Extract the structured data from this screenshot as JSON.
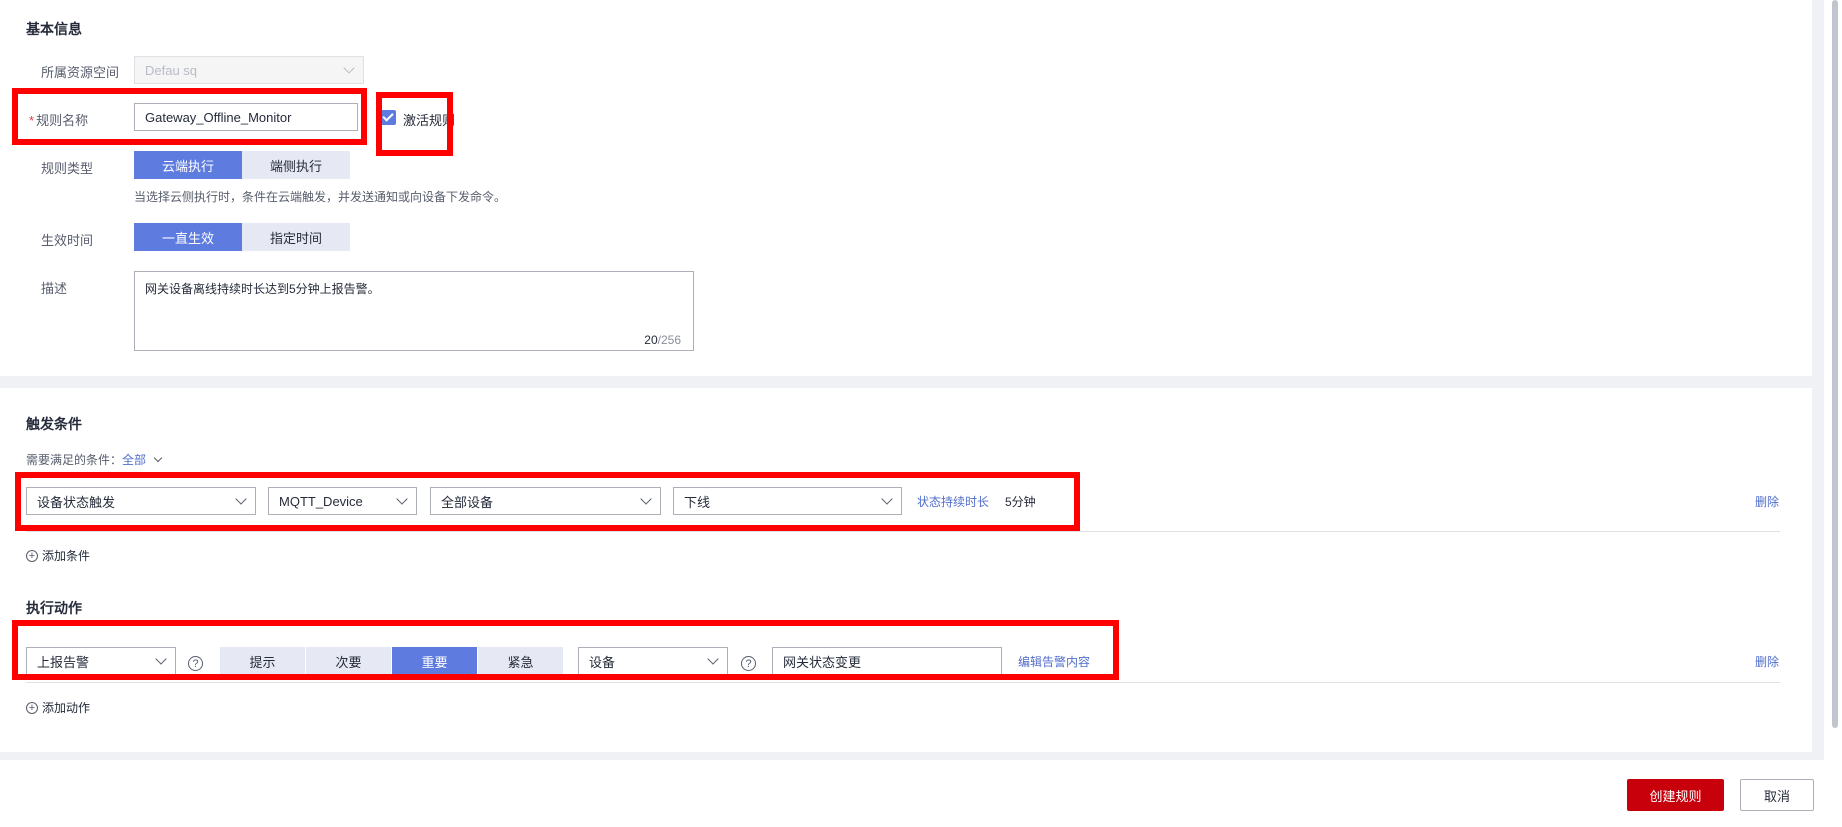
{
  "basic_info": {
    "title": "基本信息",
    "resource_space": {
      "label": "所属资源空间",
      "value": "Defau              sq"
    },
    "rule_name": {
      "required_mark": "*",
      "label": "规则名称",
      "value": "Gateway_Offline_Monitor"
    },
    "activate": {
      "label": "激活规则",
      "checked": true
    },
    "rule_type": {
      "label": "规则类型",
      "options": [
        "云端执行",
        "端侧执行"
      ],
      "selected": "云端执行",
      "hint": "当选择云侧执行时，条件在云端触发，并发送通知或向设备下发命令。"
    },
    "effective_time": {
      "label": "生效时间",
      "options": [
        "一直生效",
        "指定时间"
      ],
      "selected": "一直生效"
    },
    "description": {
      "label": "描述",
      "value": "网关设备离线持续时长达到5分钟上报告警。",
      "count": "20",
      "max": "/256"
    }
  },
  "trigger": {
    "title": "触发条件",
    "match_label": "需要满足的条件：",
    "match_value": "全部",
    "condition": {
      "type": "设备状态触发",
      "product": "MQTT_Device",
      "devices": "全部设备",
      "status": "下线",
      "duration_label": "状态持续时长",
      "duration_value": "5分钟",
      "delete": "删除"
    },
    "add_condition": "添加条件"
  },
  "action": {
    "title": "执行动作",
    "type": "上报告警",
    "severity_options": [
      "提示",
      "次要",
      "重要",
      "紧急"
    ],
    "severity_selected": "重要",
    "scope": "设备",
    "alarm_name": "网关状态变更",
    "edit_link": "编辑告警内容",
    "delete": "删除",
    "add_action": "添加动作"
  },
  "footer": {
    "create": "创建规则",
    "cancel": "取消"
  },
  "colors": {
    "primary": "#5e7ce0",
    "danger": "#c7000b",
    "highlight": "#ff0000"
  }
}
